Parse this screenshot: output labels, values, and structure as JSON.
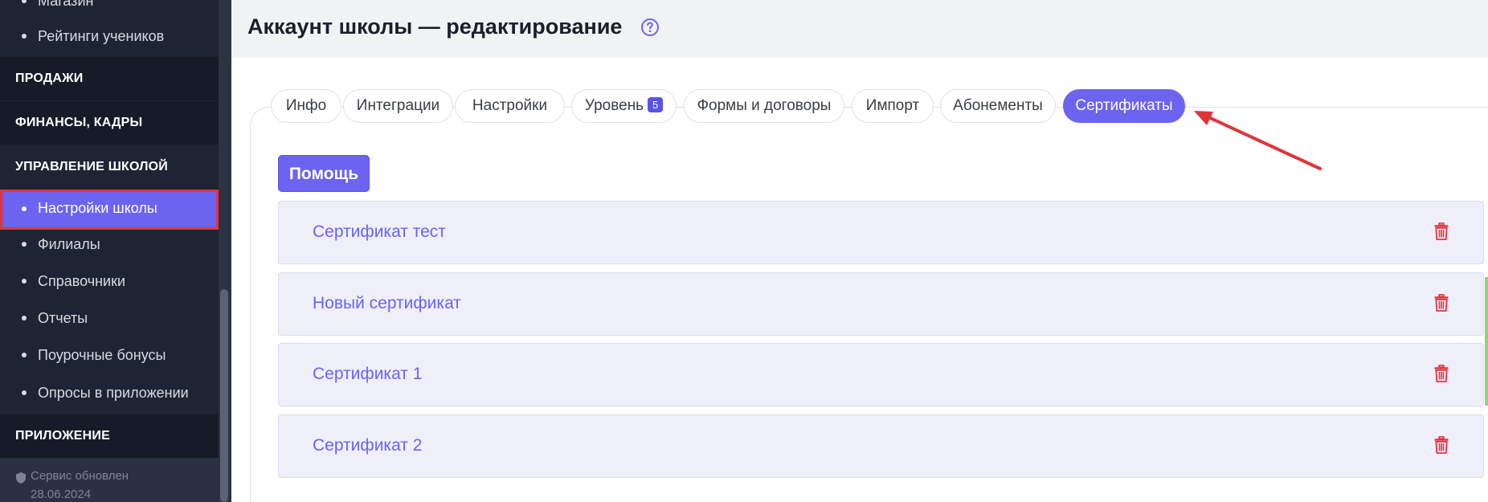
{
  "sidebar": {
    "items": [
      {
        "type": "sub",
        "label": "Магазин"
      },
      {
        "type": "sub",
        "label": "Рейтинги учеников"
      },
      {
        "type": "header",
        "label": "ПРОДАЖИ"
      },
      {
        "type": "header",
        "label": "ФИНАНСЫ, КАДРЫ"
      },
      {
        "type": "header",
        "label": "УПРАВЛЕНИЕ ШКОЛОЙ"
      },
      {
        "type": "sub",
        "label": "Настройки школы",
        "active": true
      },
      {
        "type": "sub",
        "label": "Филиалы"
      },
      {
        "type": "sub",
        "label": "Справочники"
      },
      {
        "type": "sub",
        "label": "Отчеты"
      },
      {
        "type": "sub",
        "label": "Поурочные бонусы"
      },
      {
        "type": "sub",
        "label": "Опросы в приложении"
      },
      {
        "type": "header",
        "label": "ПРИЛОЖЕНИЕ"
      }
    ],
    "footer": {
      "line1": "Сервис обновлен",
      "line2": "28.06.2024"
    }
  },
  "header": {
    "title": "Аккаунт школы — редактирование"
  },
  "tabs": [
    {
      "label": "Инфо"
    },
    {
      "label": "Интеграции"
    },
    {
      "label": "Настройки"
    },
    {
      "label": "Уровень",
      "badge": "5"
    },
    {
      "label": "Формы и договоры"
    },
    {
      "label": "Импорт"
    },
    {
      "label": "Абонементы"
    },
    {
      "label": "Сертификаты",
      "active": true
    }
  ],
  "main": {
    "help_button": "Помощь",
    "certificates": [
      {
        "name": "Сертификат тест"
      },
      {
        "name": "Новый сертификат"
      },
      {
        "name": "Сертификат 1"
      },
      {
        "name": "Сертификат 2"
      }
    ]
  },
  "colors": {
    "accent": "#6c63f0",
    "sidebar_bg": "#1e2433",
    "delete": "#e5333f",
    "annotation": "#e0343c"
  },
  "icons": {
    "help": "question-circle-icon",
    "delete": "trash-icon",
    "footer": "shield-icon"
  }
}
